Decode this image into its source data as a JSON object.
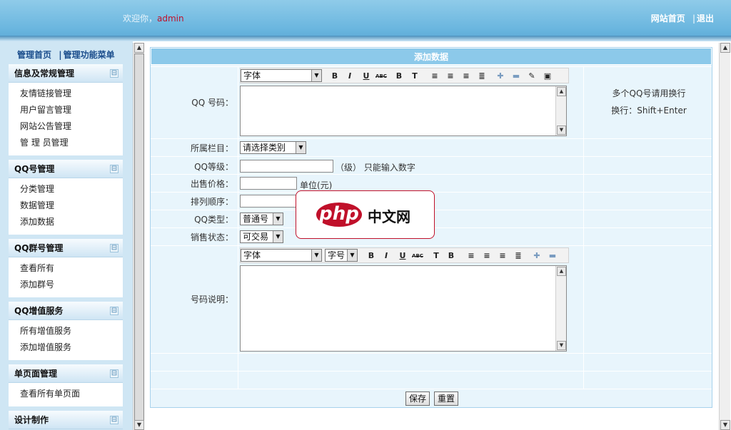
{
  "header": {
    "welcome_prefix": "欢迎你，",
    "username": "admin",
    "link_home": "网站首页",
    "link_sep": "|",
    "link_logout": "退出"
  },
  "sidebar": {
    "head_home": "管理首页",
    "head_sep": "|",
    "head_menu": "管理功能菜单",
    "toggle_glyph": "⊟",
    "groups": [
      {
        "title": "信息及常规管理",
        "items": [
          "友情链接管理",
          "用户留言管理",
          "网站公告管理",
          "管 理 员管理"
        ]
      },
      {
        "title": "QQ号管理",
        "items": [
          "分类管理",
          "数据管理",
          "添加数据"
        ]
      },
      {
        "title": "QQ群号管理",
        "items": [
          "查看所有",
          "添加群号"
        ]
      },
      {
        "title": "QQ增值服务",
        "items": [
          "所有增值服务",
          "添加增值服务"
        ]
      },
      {
        "title": "单页面管理",
        "items": [
          "查看所有单页面"
        ]
      },
      {
        "title": "设计制作",
        "items": []
      }
    ]
  },
  "form": {
    "title": "添加数据",
    "qq_label": "QQ 号码：",
    "qq_tip1": "多个QQ号请用换行",
    "qq_tip2": "换行：Shift+Enter",
    "editor1_font": "字体",
    "category_label": "所属栏目：",
    "category_value": "请选择类别",
    "level_label": "QQ等级：",
    "level_note": "（级） 只能输入数字",
    "price_label": "出售价格：",
    "price_note": "单位(元)",
    "order_label": "排列顺序：",
    "type_label": "QQ类型：",
    "type_value": "普通号",
    "status_label": "销售状态：",
    "status_value": "可交易",
    "desc_label": "号码说明：",
    "editor2_font": "字体",
    "editor2_size": "字号",
    "save_label": "保存",
    "reset_label": "重置"
  },
  "watermark": {
    "logo": "php",
    "text": "中文网"
  }
}
